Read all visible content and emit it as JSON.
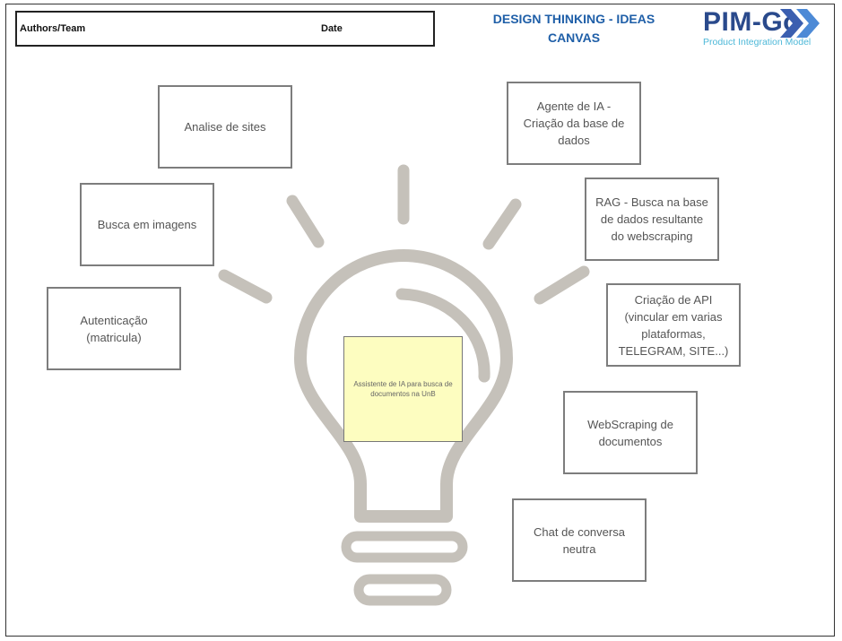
{
  "header": {
    "authors_label": "Authors/Team",
    "date_label": "Date",
    "title_line1": "DESIGN THINKING - IDEAS",
    "title_line2": "CANVAS",
    "logo_text": "PIM-Go",
    "logo_subtitle": "Product Integration Model",
    "logo_icon": "double-chevron-right-icon"
  },
  "center_idea": "Assistente de IA para busca de documentos na UnB",
  "ideas": [
    "Analise de sites",
    "Busca em imagens",
    "Autenticação (matricula)",
    "Agente de IA - Criação da base de dados",
    "RAG - Busca na base de dados resultante do webscraping",
    "Criação de API (vincular em varias plataformas, TELEGRAM, SITE...)",
    "WebScraping de documentos",
    "Chat de conversa neutra"
  ],
  "colors": {
    "title": "#1f5fa8",
    "logo_main": "#2a4a8c",
    "logo_sub": "#4db8d8",
    "bulb": "#c5c1ba",
    "center_note": "#fdfdc0"
  }
}
